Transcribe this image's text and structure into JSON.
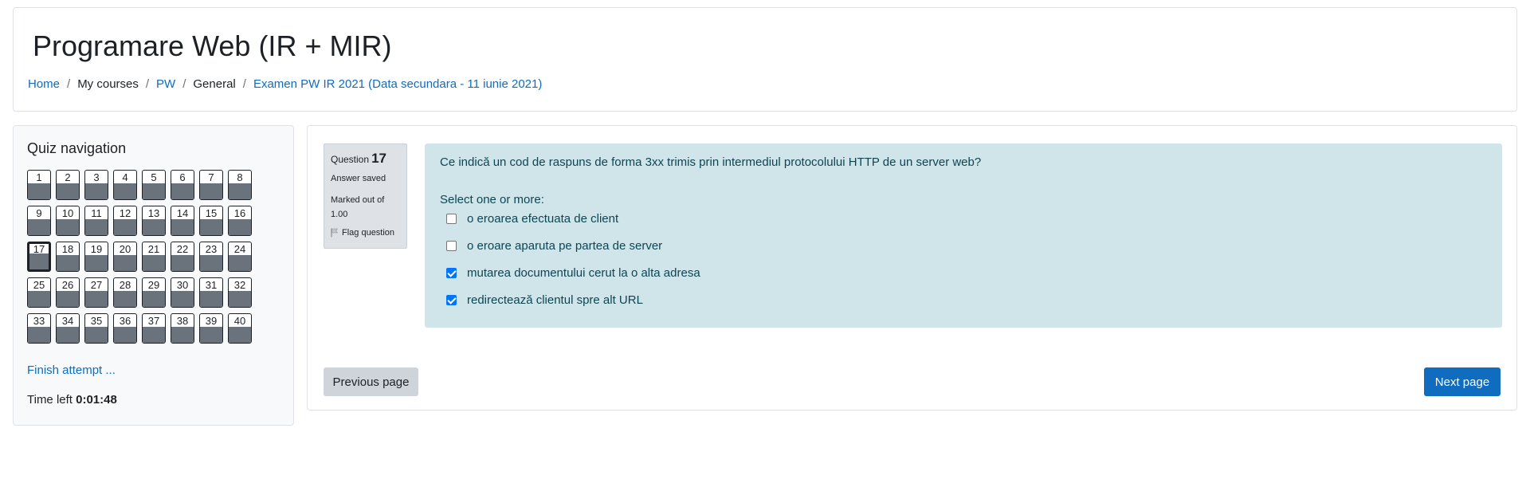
{
  "header": {
    "title": "Programare Web (IR + MIR)",
    "breadcrumb": [
      {
        "label": "Home",
        "link": true
      },
      {
        "label": "My courses",
        "link": false
      },
      {
        "label": "PW",
        "link": true
      },
      {
        "label": "General",
        "link": false
      },
      {
        "label": "Examen PW IR 2021 (Data secundara - 11 iunie 2021)",
        "link": true
      }
    ]
  },
  "quiz_nav": {
    "title": "Quiz navigation",
    "current": 17,
    "questions": [
      "1",
      "2",
      "3",
      "4",
      "5",
      "6",
      "7",
      "8",
      "9",
      "10",
      "11",
      "12",
      "13",
      "14",
      "15",
      "16",
      "17",
      "18",
      "19",
      "20",
      "21",
      "22",
      "23",
      "24",
      "25",
      "26",
      "27",
      "28",
      "29",
      "30",
      "31",
      "32",
      "33",
      "34",
      "35",
      "36",
      "37",
      "38",
      "39",
      "40"
    ],
    "finish_label": "Finish attempt ...",
    "time_left_label": "Time left",
    "time_left_value": "0:01:48"
  },
  "question": {
    "label": "Question",
    "number": "17",
    "state": "Answer saved",
    "grade": "Marked out of 1.00",
    "flag_label": "Flag question",
    "text": "Ce indică un cod de raspuns de forma 3xx trimis prin intermediul protocolului HTTP de un server web?",
    "prompt": "Select one or more:",
    "answers": [
      {
        "label": "o eroarea efectuata de client",
        "checked": false
      },
      {
        "label": "o eroare aparuta pe partea de server",
        "checked": false
      },
      {
        "label": "mutarea documentului cerut la o alta adresa",
        "checked": true
      },
      {
        "label": "redirectează clientul spre alt URL",
        "checked": true
      }
    ]
  },
  "buttons": {
    "previous": "Previous page",
    "next": "Next page"
  },
  "colors": {
    "link": "#0f6cbf",
    "question_bg": "#cfe5ea",
    "answered_fill": "#6a737b",
    "primary_button": "#0f6cbf"
  }
}
